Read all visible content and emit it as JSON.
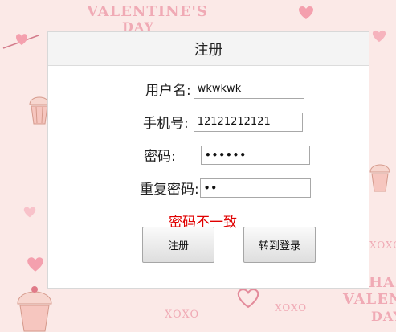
{
  "background": {
    "text_top": "VALENTINE'S",
    "text_top2": "DAY",
    "text_right1": "HAPPY",
    "text_right2": "VALENTINE'S",
    "text_right3": "DAY",
    "xoxo_left": "XOXO",
    "xoxo_right": "XOXO",
    "xoxo_side": "XOXO"
  },
  "dialog": {
    "title": "注册",
    "username_label": "用户名:",
    "username_value": "wkwkwk",
    "phone_label": "手机号:",
    "phone_value": "12121212121",
    "password_label": "密码:",
    "password_value": "••••••",
    "confirm_label": "重复密码:",
    "confirm_value": "••",
    "error_message": "密码不一致",
    "register_button": "注册",
    "login_button": "转到登录"
  },
  "colors": {
    "error": "#e00000",
    "background": "#fbe9e7",
    "accent_pink": "#f2a6b3"
  }
}
